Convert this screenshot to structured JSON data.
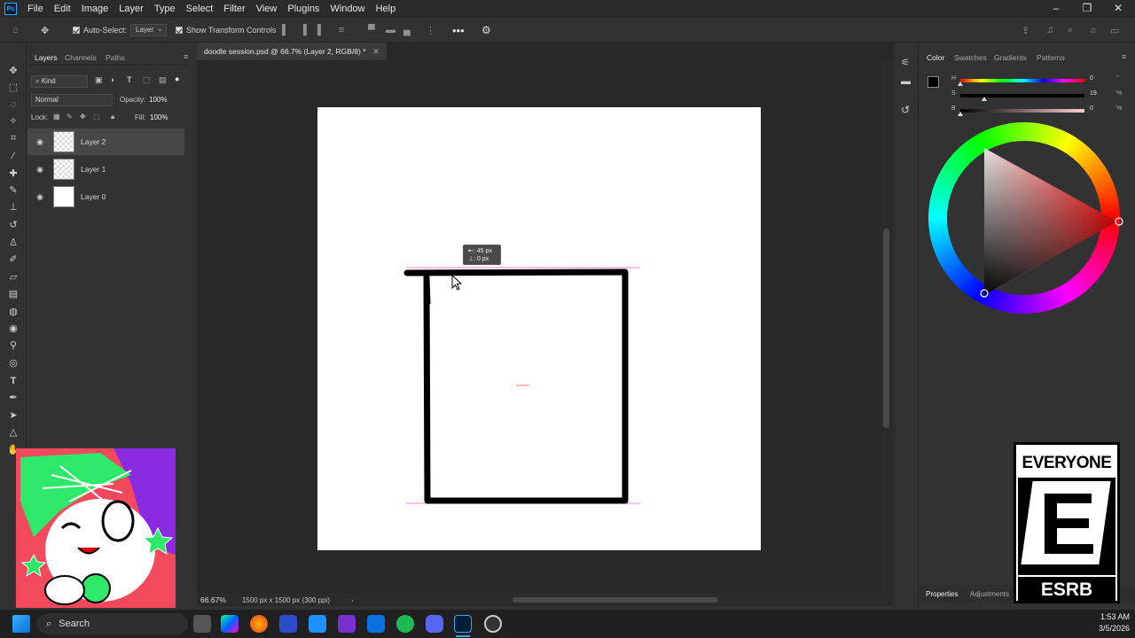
{
  "menu": [
    "File",
    "Edit",
    "Image",
    "Layer",
    "Type",
    "Select",
    "Filter",
    "View",
    "Plugins",
    "Window",
    "Help"
  ],
  "app_logo": "Ps",
  "options_bar": {
    "auto_select_label": "Auto-Select:",
    "auto_select_target": "Layer",
    "show_transform_label": "Show Transform Controls"
  },
  "layers_panel": {
    "tabs": [
      "Layers",
      "Channels",
      "Paths"
    ],
    "filter_kind": "Kind",
    "blend_mode": "Normal",
    "opacity_label": "Opacity:",
    "opacity_value": "100%",
    "lock_label": "Lock:",
    "fill_label": "Fill:",
    "fill_value": "100%",
    "layers": [
      {
        "name": "Layer 2",
        "selected": true
      },
      {
        "name": "Layer 1",
        "selected": false
      },
      {
        "name": "Layer 0",
        "selected": false
      }
    ]
  },
  "document": {
    "tab_title": "doodle session.psd @ 66.7% (Layer 2, RGB/8) *",
    "zoom": "66.67%",
    "doc_info": "1500 px x 1500 px (300 ppi)",
    "move_readout_x": "45 px",
    "move_readout_y": "0 px"
  },
  "color_panel": {
    "tabs": [
      "Color",
      "Swatches",
      "Gradients",
      "Patterns"
    ],
    "sliders": [
      {
        "label": "H",
        "value": "0",
        "unit": "°"
      },
      {
        "label": "S",
        "value": "19",
        "unit": "%"
      },
      {
        "label": "B",
        "value": "0",
        "unit": "%"
      }
    ],
    "bottom_tabs": [
      "Properties",
      "Adjustments"
    ]
  },
  "esrb": {
    "top_text": "EVERYONE",
    "letter": "E",
    "brand": "ESRB"
  },
  "taskbar": {
    "search_label": "Search",
    "time": "1:53 AM",
    "date": "3/5/2026"
  },
  "colors": {
    "accent": "#31a8ff",
    "panel_bg": "#323232",
    "canvas_bg": "#282828",
    "guide": "#ff4fd8"
  }
}
